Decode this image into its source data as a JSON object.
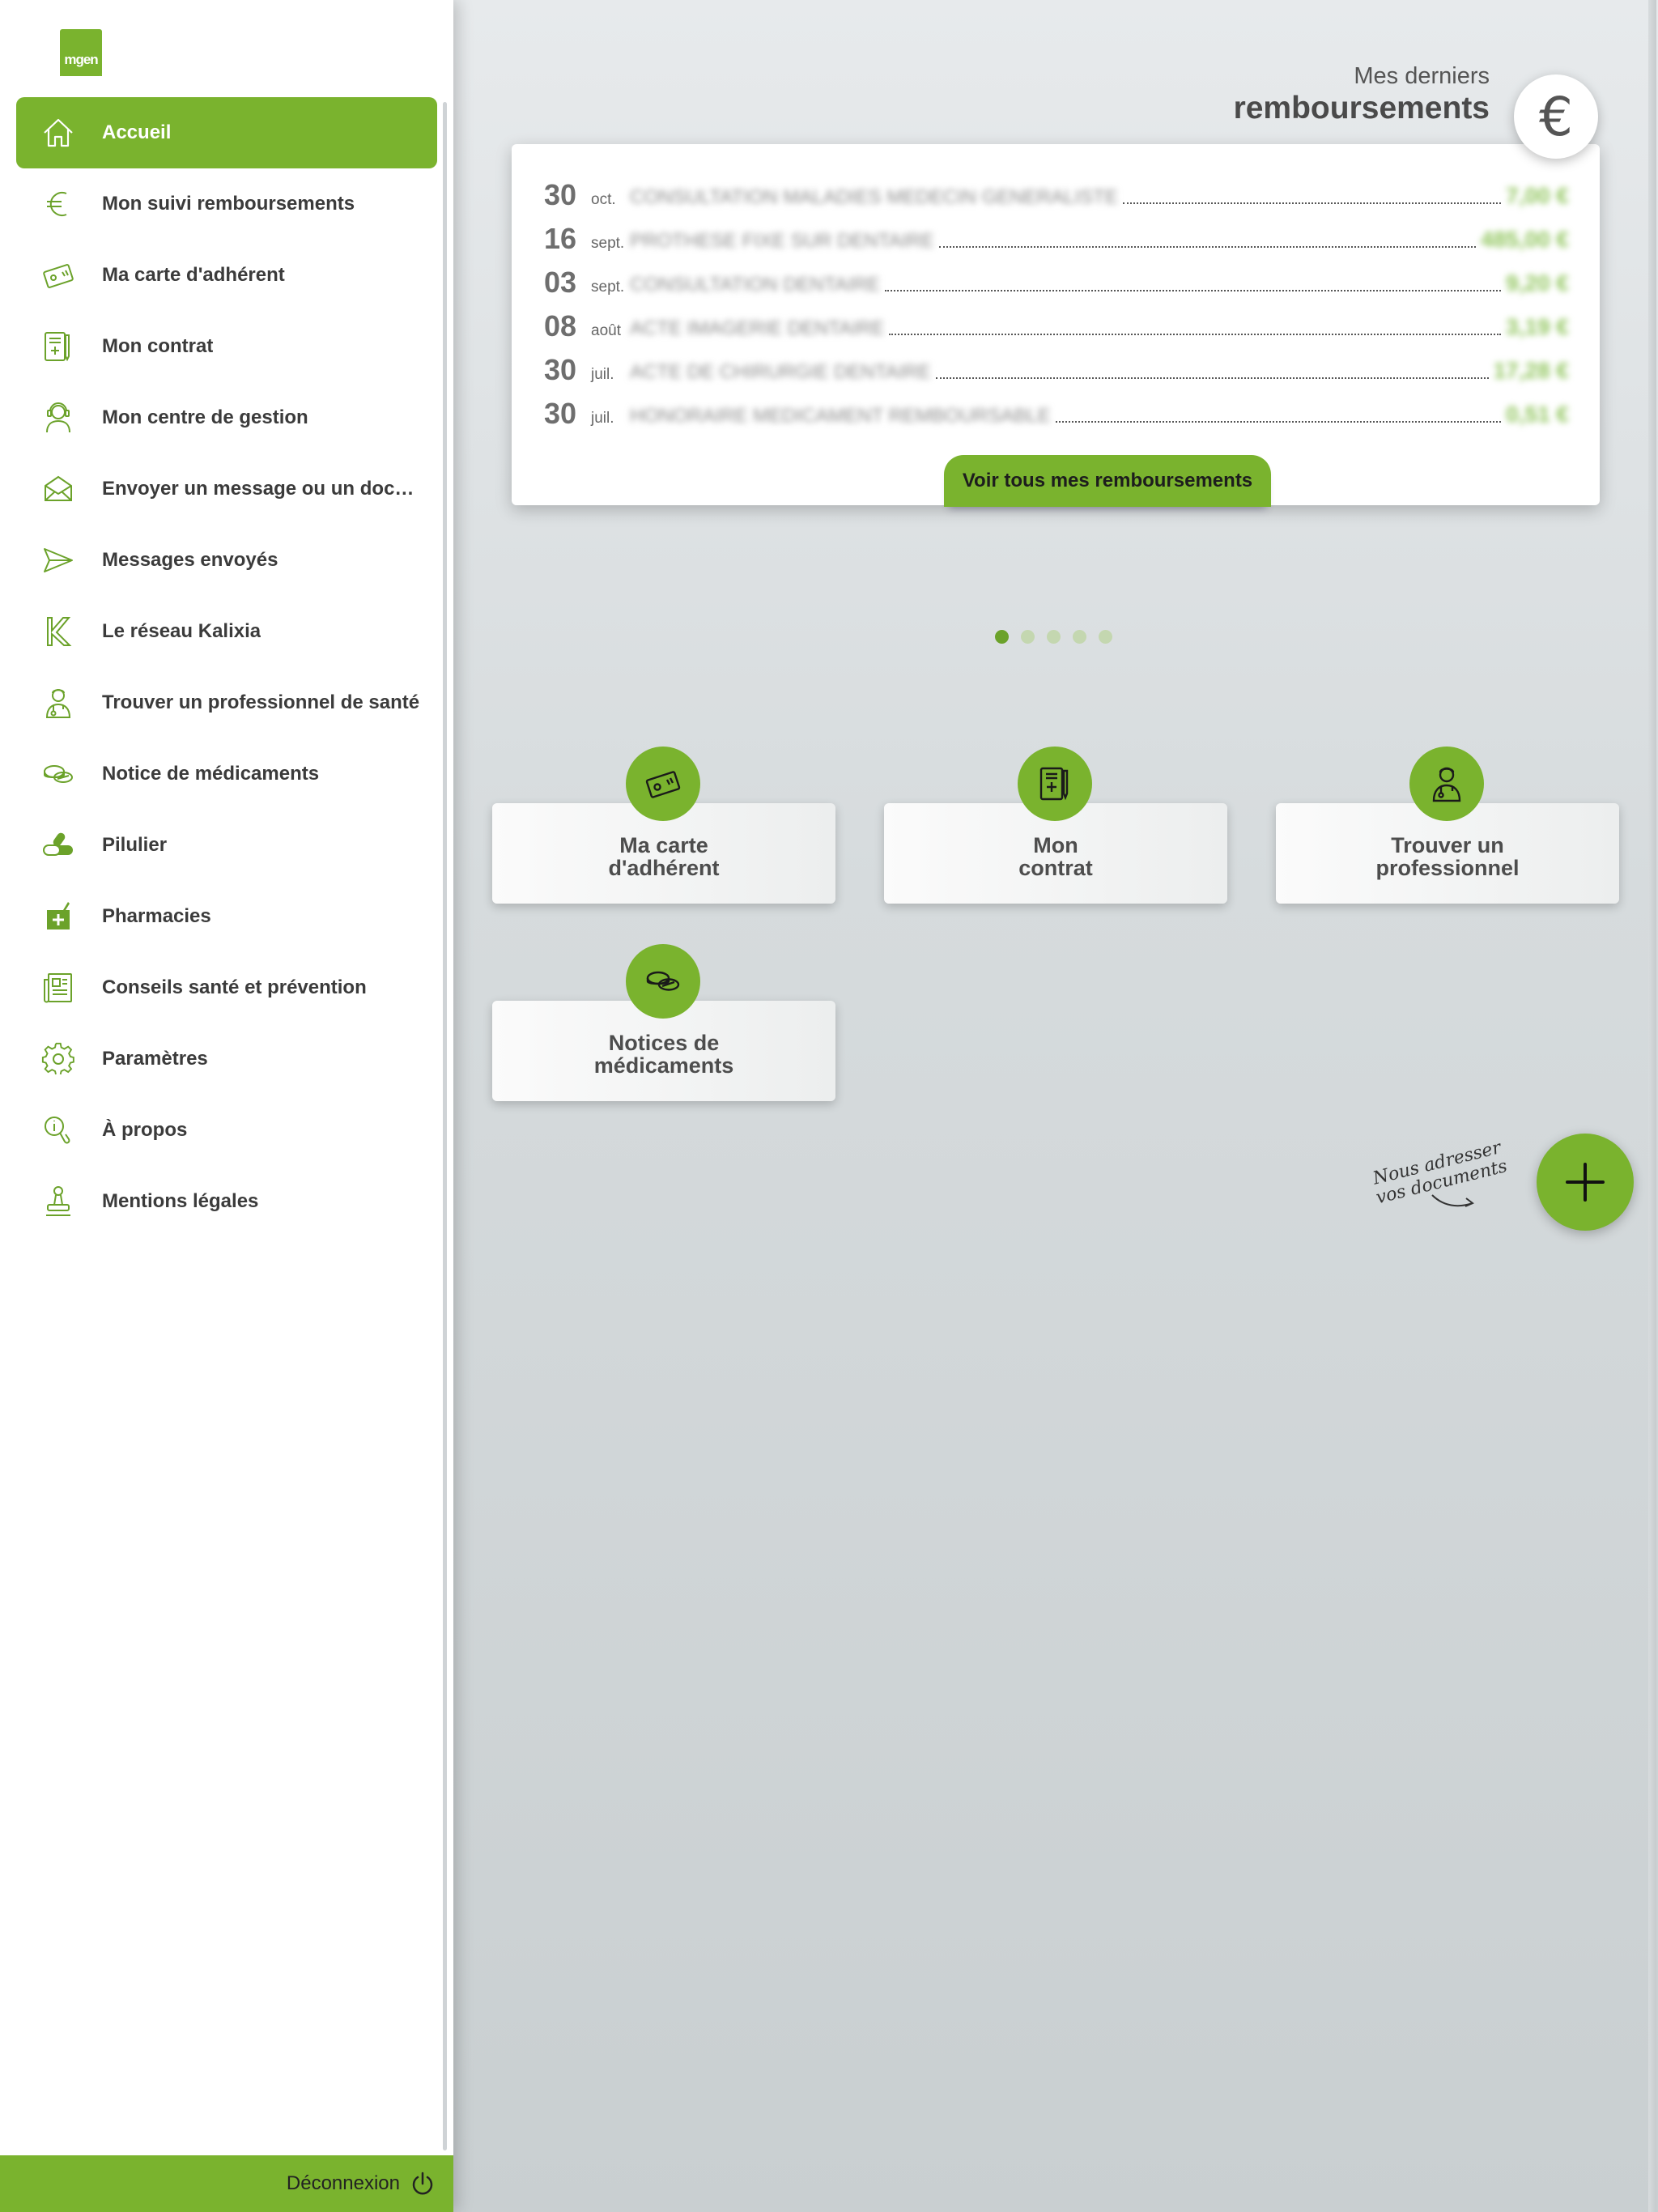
{
  "logo": {
    "text": "mgen"
  },
  "menu": [
    {
      "label": "Accueil",
      "icon": "home-icon",
      "active": true
    },
    {
      "label": "Mon suivi remboursements",
      "icon": "euro-icon"
    },
    {
      "label": "Ma carte d'adhérent",
      "icon": "card-icon"
    },
    {
      "label": "Mon contrat",
      "icon": "contract-icon"
    },
    {
      "label": "Mon centre de gestion",
      "icon": "advisor-icon"
    },
    {
      "label": "Envoyer un message ou un document",
      "icon": "envelope-icon"
    },
    {
      "label": "Messages envoyés",
      "icon": "send-icon"
    },
    {
      "label": "Le réseau Kalixia",
      "icon": "kalixia-icon"
    },
    {
      "label": "Trouver un professionnel de santé",
      "icon": "doctor-icon"
    },
    {
      "label": "Notice de médicaments",
      "icon": "pills-icon"
    },
    {
      "label": "Pilulier",
      "icon": "pill-box-icon"
    },
    {
      "label": "Pharmacies",
      "icon": "pharmacy-icon"
    },
    {
      "label": "Conseils santé et prévention",
      "icon": "newspaper-icon"
    },
    {
      "label": "Paramètres",
      "icon": "gear-icon"
    },
    {
      "label": "À propos",
      "icon": "info-icon"
    },
    {
      "label": "Mentions légales",
      "icon": "stamp-icon"
    }
  ],
  "logout": {
    "label": "Déconnexion",
    "icon": "power-icon"
  },
  "reimbursements": {
    "title_small": "Mes derniers",
    "title_big": "remboursements",
    "icon": "euro-icon",
    "rows": [
      {
        "day": "30",
        "month": "oct.",
        "desc": "CONSULTATION MALADIES MEDECIN GENERALISTE",
        "amount": "7,00 €"
      },
      {
        "day": "16",
        "month": "sept.",
        "desc": "PROTHESE FIXE SUR DENTAIRE",
        "amount": "485,00 €"
      },
      {
        "day": "03",
        "month": "sept.",
        "desc": "CONSULTATION DENTAIRE",
        "amount": "9,20 €"
      },
      {
        "day": "08",
        "month": "août",
        "desc": "ACTE IMAGERIE DENTAIRE",
        "amount": "3,19 €"
      },
      {
        "day": "30",
        "month": "juil.",
        "desc": "ACTE DE CHIRURGIE DENTAIRE",
        "amount": "17,28 €"
      },
      {
        "day": "30",
        "month": "juil.",
        "desc": "HONORAIRE MEDICAMENT REMBOURSABLE",
        "amount": "0,51 €"
      }
    ],
    "see_all_label": "Voir tous mes remboursements"
  },
  "pagination": {
    "count": 5,
    "active": 0
  },
  "tiles": [
    {
      "label_line1": "Ma carte",
      "label_line2": "d'adhérent",
      "icon": "card-icon"
    },
    {
      "label_line1": "Mon",
      "label_line2": "contrat",
      "icon": "contract-icon"
    },
    {
      "label_line1": "Trouver un",
      "label_line2": "professionnel",
      "icon": "doctor-icon"
    },
    {
      "label_line1": "Notices de",
      "label_line2": "médicaments",
      "icon": "pills-icon"
    }
  ],
  "fab": {
    "note_line1": "Nous adresser",
    "note_line2": "vos documents",
    "icon": "plus-icon"
  },
  "colors": {
    "accent": "#7ab32e",
    "accent_dark": "#6ba22a",
    "amount": "#8ec45a"
  }
}
